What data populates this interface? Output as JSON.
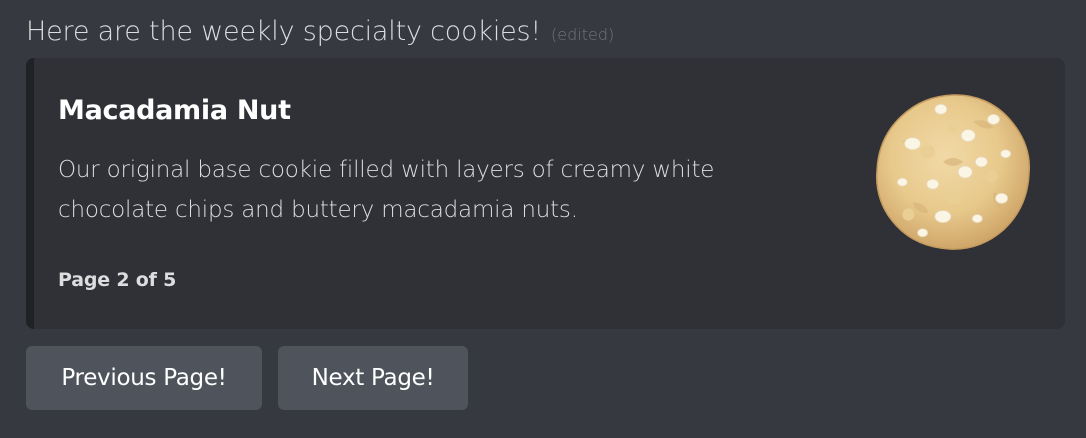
{
  "message": {
    "text": "Here are the weekly specialty cookies!",
    "edited_label": "(edited)"
  },
  "embed": {
    "title": "Macadamia Nut",
    "description": "Our original base cookie filled with layers of creamy white chocolate chips and buttery macadamia nuts.",
    "footer": "Page 2 of 5",
    "accent_color": "#202225",
    "thumbnail_icon": "cookie-image"
  },
  "buttons": {
    "previous_label": "Previous Page!",
    "next_label": "Next Page!"
  },
  "colors": {
    "background": "#36393f",
    "embed_background": "#2f3136",
    "button_background": "#4f545c"
  }
}
